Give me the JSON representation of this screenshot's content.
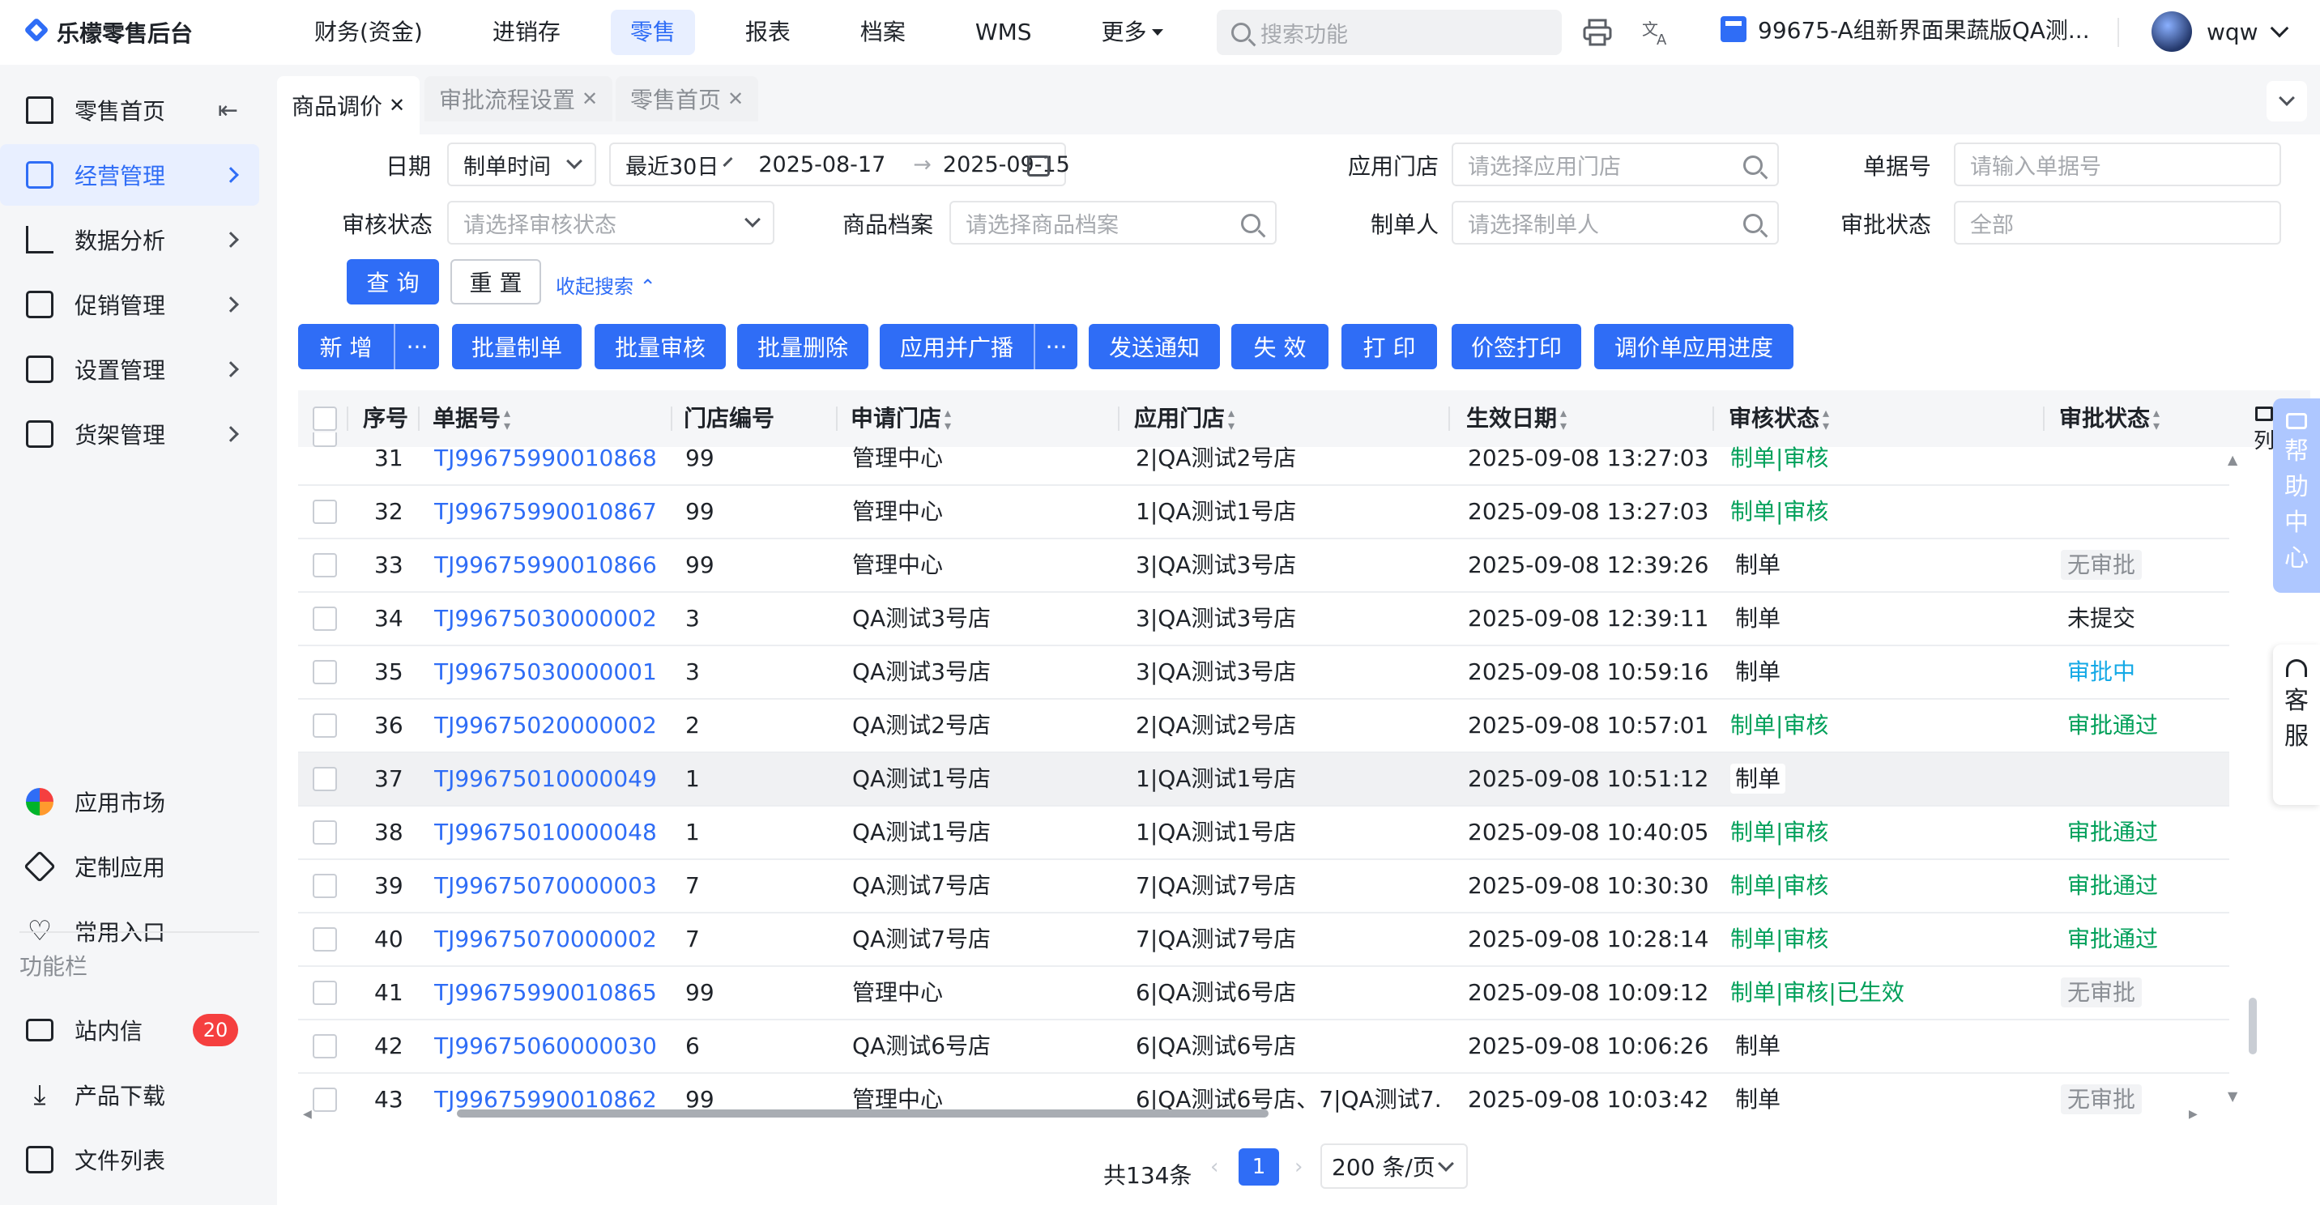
{
  "app": {
    "name": "乐檬零售后台"
  },
  "topnav": [
    "财务(资金)",
    "进销存",
    "零售",
    "报表",
    "档案",
    "WMS"
  ],
  "topnav_more": "更多",
  "search": {
    "placeholder": "搜索功能"
  },
  "store": "99675-A组新界面果蔬版QA测...",
  "user": "wqw",
  "sidebar": {
    "items": [
      "零售首页",
      "经营管理",
      "数据分析",
      "促销管理",
      "设置管理",
      "货架管理"
    ],
    "apps": [
      "应用市场",
      "定制应用",
      "常用入口"
    ],
    "section_title": "功能栏",
    "bottom": [
      "站内信",
      "产品下载",
      "文件列表"
    ],
    "message_count": "20"
  },
  "tabs": [
    "商品调价",
    "审批流程设置",
    "零售首页"
  ],
  "filters": {
    "date_label": "日期",
    "date_type": "制单时间",
    "date_range": "最近30日",
    "date_from": "2025-08-17",
    "date_arrow": "→",
    "date_to": "2025-09-15",
    "store_label": "应用门店",
    "store_ph": "请选择应用门店",
    "docno_label": "单据号",
    "docno_ph": "请输入单据号",
    "audit_label": "审核状态",
    "audit_ph": "请选择审核状态",
    "goods_label": "商品档案",
    "goods_ph": "请选择商品档案",
    "maker_label": "制单人",
    "maker_ph": "请选择制单人",
    "approval_label": "审批状态",
    "approval_value": "全部",
    "query": "查 询",
    "reset": "重 置",
    "collapse": "收起搜索"
  },
  "toolbar": [
    "新 增",
    "批量制单",
    "批量审核",
    "批量删除",
    "应用并广播",
    "发送通知",
    "失 效",
    "打 印",
    "价签打印",
    "调价单应用进度"
  ],
  "toolbar_more": "···",
  "columns": [
    "序号",
    "单据号",
    "门店编号",
    "申请门店",
    "应用门店",
    "生效日期",
    "审核状态",
    "审批状态"
  ],
  "column_settings": "列",
  "rows": [
    {
      "no": "31",
      "doc": "TJ99675990010868",
      "code": "99",
      "apply": "管理中心",
      "target": "2|QA测试2号店",
      "date": "2025-09-08 13:27:03",
      "audit": "制单|审核",
      "approval": ""
    },
    {
      "no": "32",
      "doc": "TJ99675990010867",
      "code": "99",
      "apply": "管理中心",
      "target": "1|QA测试1号店",
      "date": "2025-09-08 13:27:03",
      "audit": "制单|审核",
      "approval": ""
    },
    {
      "no": "33",
      "doc": "TJ99675990010866",
      "code": "99",
      "apply": "管理中心",
      "target": "3|QA测试3号店",
      "date": "2025-09-08 12:39:26",
      "audit": "制单",
      "approval": "无审批"
    },
    {
      "no": "34",
      "doc": "TJ99675030000002",
      "code": "3",
      "apply": "QA测试3号店",
      "target": "3|QA测试3号店",
      "date": "2025-09-08 12:39:11",
      "audit": "制单",
      "approval": "未提交"
    },
    {
      "no": "35",
      "doc": "TJ99675030000001",
      "code": "3",
      "apply": "QA测试3号店",
      "target": "3|QA测试3号店",
      "date": "2025-09-08 10:59:16",
      "audit": "制单",
      "approval": "审批中"
    },
    {
      "no": "36",
      "doc": "TJ99675020000002",
      "code": "2",
      "apply": "QA测试2号店",
      "target": "2|QA测试2号店",
      "date": "2025-09-08 10:57:01",
      "audit": "制单|审核",
      "approval": "审批通过"
    },
    {
      "no": "37",
      "doc": "TJ99675010000049",
      "code": "1",
      "apply": "QA测试1号店",
      "target": "1|QA测试1号店",
      "date": "2025-09-08 10:51:12",
      "audit": "制单",
      "approval": ""
    },
    {
      "no": "38",
      "doc": "TJ99675010000048",
      "code": "1",
      "apply": "QA测试1号店",
      "target": "1|QA测试1号店",
      "date": "2025-09-08 10:40:05",
      "audit": "制单|审核",
      "approval": "审批通过"
    },
    {
      "no": "39",
      "doc": "TJ99675070000003",
      "code": "7",
      "apply": "QA测试7号店",
      "target": "7|QA测试7号店",
      "date": "2025-09-08 10:30:30",
      "audit": "制单|审核",
      "approval": "审批通过"
    },
    {
      "no": "40",
      "doc": "TJ99675070000002",
      "code": "7",
      "apply": "QA测试7号店",
      "target": "7|QA测试7号店",
      "date": "2025-09-08 10:28:14",
      "audit": "制单|审核",
      "approval": "审批通过"
    },
    {
      "no": "41",
      "doc": "TJ99675990010865",
      "code": "99",
      "apply": "管理中心",
      "target": "6|QA测试6号店",
      "date": "2025-09-08 10:09:12",
      "audit": "制单|审核|已生效",
      "approval": "无审批"
    },
    {
      "no": "42",
      "doc": "TJ99675060000030",
      "code": "6",
      "apply": "QA测试6号店",
      "target": "6|QA测试6号店",
      "date": "2025-09-08 10:06:26",
      "audit": "制单",
      "approval": ""
    },
    {
      "no": "43",
      "doc": "TJ99675990010862",
      "code": "99",
      "apply": "管理中心",
      "target": "6|QA测试6号店、7|QA测试7…",
      "date": "2025-09-08 10:03:42",
      "audit": "制单",
      "approval": "无审批"
    }
  ],
  "pagination": {
    "total": "共134条",
    "current": "1",
    "page_size": "200 条/页"
  },
  "float": {
    "help": "帮助中心",
    "service": "客服"
  },
  "colors": {
    "primary": "#2f6df6",
    "success": "#00a05a",
    "processing": "#14a9e6",
    "danger": "#f53f3f"
  }
}
